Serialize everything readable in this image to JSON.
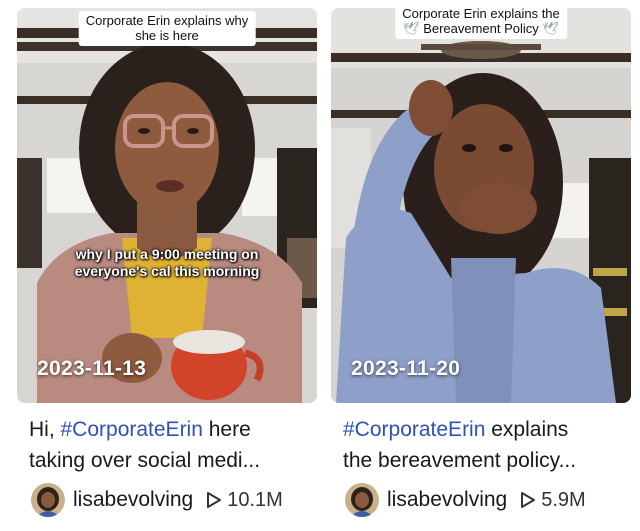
{
  "videos": [
    {
      "banner_line1": "Corporate Erin explains why",
      "banner_line2": "she is here",
      "caption_line1": "why I put a 9:00 meeting on",
      "caption_line2": "everyone's cal this morning",
      "date": "2023-11-13",
      "desc_prefix": "Hi, ",
      "desc_tag": "#CorporateErin",
      "desc_line1_rest": " here",
      "desc_line2": "taking over social medi...",
      "username": "lisabevolving",
      "views": "10.1M"
    },
    {
      "banner_line1": "Corporate Erin explains the",
      "banner_line2": "Bereavement Policy",
      "banner_emoji": "🕊",
      "date": "2023-11-20",
      "desc_tag": "#CorporateErin",
      "desc_line1_rest": " explains",
      "desc_line2": "the bereavement policy...",
      "username": "lisabevolving",
      "views": "5.9M"
    }
  ],
  "icons": {
    "play": "play-icon",
    "avatar": "avatar",
    "dove": "dove-icon"
  },
  "colors": {
    "hashtag": "#2f51b6",
    "text": "#161823"
  }
}
